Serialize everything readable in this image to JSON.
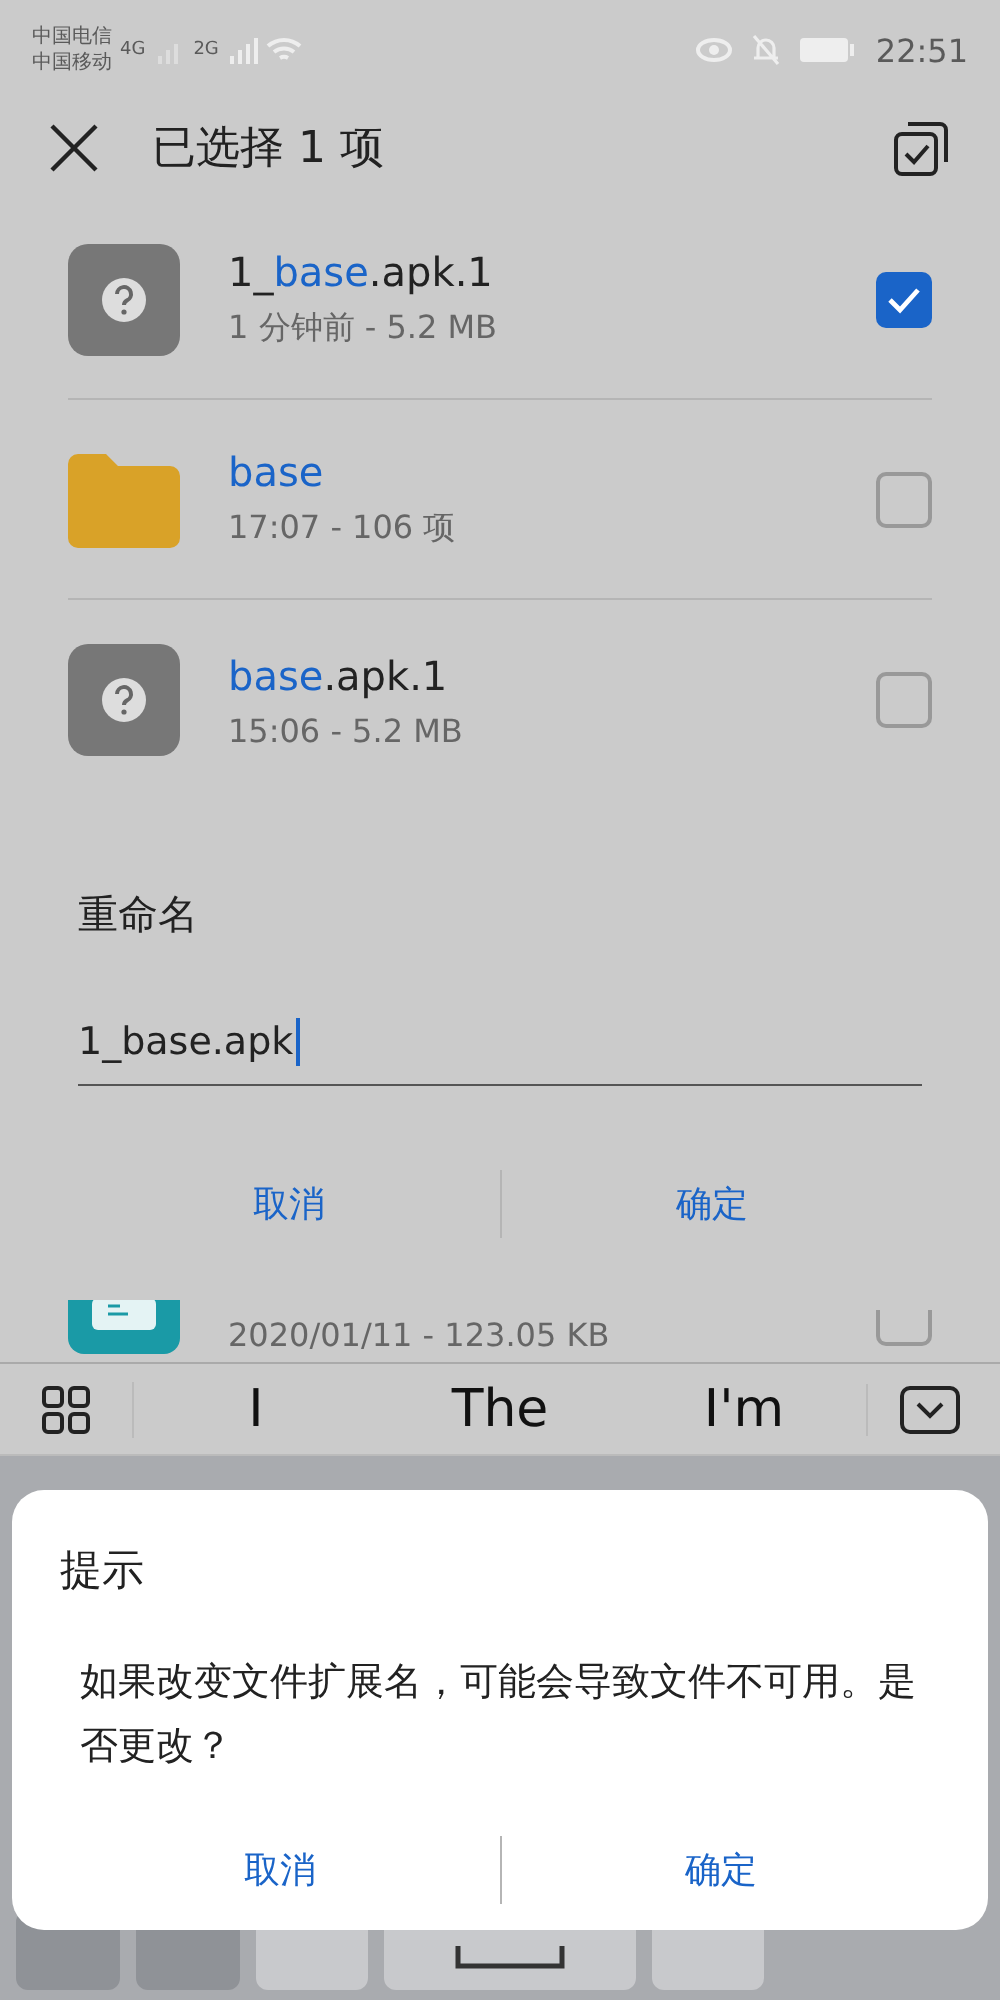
{
  "status_bar": {
    "carriers": [
      "中国电信",
      "中国移动"
    ],
    "network_1": "4G",
    "network_2": "2G",
    "time": "22:51"
  },
  "header": {
    "title": "已选择 1 项"
  },
  "files": [
    {
      "kind": "unknown",
      "name_parts": [
        {
          "text": "1_",
          "highlight": false
        },
        {
          "text": "base",
          "highlight": true
        },
        {
          "text": ".apk.1",
          "highlight": false
        }
      ],
      "details": "1 分钟前 - 5.2 MB",
      "checked": true
    },
    {
      "kind": "folder",
      "name_parts": [
        {
          "text": "base",
          "highlight": true
        }
      ],
      "details": "17:07 - 106 项",
      "checked": false
    },
    {
      "kind": "unknown",
      "name_parts": [
        {
          "text": "base",
          "highlight": true
        },
        {
          "text": ".apk.1",
          "highlight": false
        }
      ],
      "details": "15:06 - 5.2 MB",
      "checked": false
    }
  ],
  "rename": {
    "title": "重命名",
    "value": "1_base.apk",
    "buttons": [
      "取消",
      "确定"
    ]
  },
  "partial_file": {
    "details": "2020/01/11 - 123.05 KB",
    "checked": false
  },
  "suggestions": [
    "I",
    "The",
    "I'm"
  ],
  "keys": [
    {
      "kind": "function"
    },
    {
      "kind": "function"
    },
    {
      "kind": "letter"
    },
    {
      "kind": "space"
    },
    {
      "kind": "letter"
    }
  ],
  "prompt": {
    "title": "提示",
    "message": "如果改变文件扩展名，可能会导致文件不可用。是否更改？",
    "buttons": [
      "取消",
      "确定"
    ]
  }
}
